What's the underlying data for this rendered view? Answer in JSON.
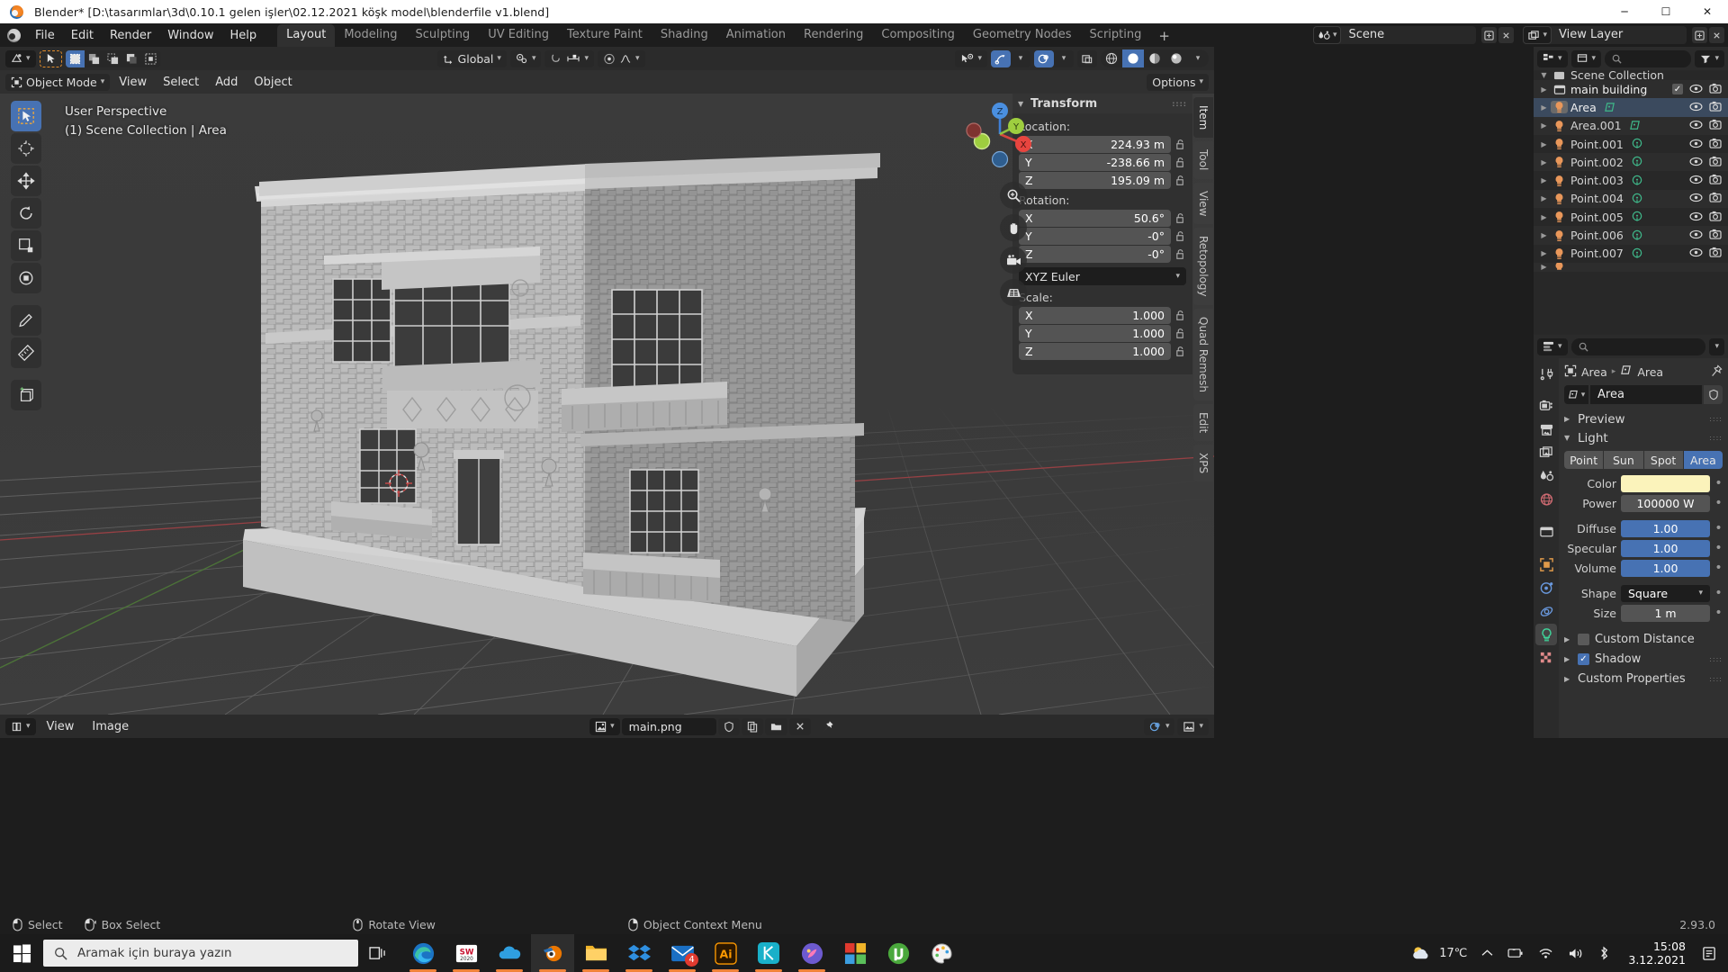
{
  "window": {
    "title": "Blender* [D:\\tasarımlar\\3d\\0.10.1 gelen işler\\02.12.2021 köşk model\\blenderfile v1.blend]",
    "minimize": "─",
    "maximize": "☐",
    "close": "✕"
  },
  "topbar": {
    "menus": [
      "File",
      "Edit",
      "Render",
      "Window",
      "Help"
    ],
    "workspaces": [
      {
        "label": "Layout",
        "active": true
      },
      {
        "label": "Modeling",
        "active": false
      },
      {
        "label": "Sculpting",
        "active": false
      },
      {
        "label": "UV Editing",
        "active": false
      },
      {
        "label": "Texture Paint",
        "active": false
      },
      {
        "label": "Shading",
        "active": false
      },
      {
        "label": "Animation",
        "active": false
      },
      {
        "label": "Rendering",
        "active": false
      },
      {
        "label": "Compositing",
        "active": false
      },
      {
        "label": "Geometry Nodes",
        "active": false
      },
      {
        "label": "Scripting",
        "active": false
      }
    ],
    "add_workspace": "+",
    "scene_name": "Scene",
    "view_layer_name": "View Layer"
  },
  "viewport": {
    "mode": "Object Mode",
    "menus": [
      "View",
      "Select",
      "Add",
      "Object"
    ],
    "transform_orientation": "Global",
    "options_label": "Options",
    "overlay_text_line1": "User Perspective",
    "overlay_text_line2": "(1) Scene Collection | Area",
    "gizmo_axes": [
      "X",
      "Y",
      "Z"
    ]
  },
  "npanel": {
    "title": "Transform",
    "location_label": "Location:",
    "rotation_label": "Rotation:",
    "scale_label": "Scale:",
    "location": [
      {
        "axis": "X",
        "value": "224.93 m"
      },
      {
        "axis": "Y",
        "value": "-238.66 m"
      },
      {
        "axis": "Z",
        "value": "195.09 m"
      }
    ],
    "rotation": [
      {
        "axis": "X",
        "value": "50.6°"
      },
      {
        "axis": "Y",
        "value": "-0°"
      },
      {
        "axis": "Z",
        "value": "-0°"
      }
    ],
    "rotation_mode": "XYZ Euler",
    "scale": [
      {
        "axis": "X",
        "value": "1.000"
      },
      {
        "axis": "Y",
        "value": "1.000"
      },
      {
        "axis": "Z",
        "value": "1.000"
      }
    ],
    "tabs": [
      {
        "label": "Item",
        "active": true
      },
      {
        "label": "Tool",
        "active": false
      },
      {
        "label": "View",
        "active": false
      },
      {
        "label": "Retopology",
        "active": false
      },
      {
        "label": "Quad Remesh",
        "active": false
      },
      {
        "label": "Edit",
        "active": false
      },
      {
        "label": "XPS",
        "active": false
      }
    ]
  },
  "image_editor": {
    "menus": [
      "View",
      "Image"
    ],
    "image_name": "main.png"
  },
  "outliner": {
    "search_placeholder": "",
    "root": "Scene Collection",
    "rows": [
      {
        "name": "main building",
        "icon": "collection-icon",
        "data_icon": "",
        "checkbox": true,
        "selected": false
      },
      {
        "name": "Area",
        "icon": "light-icon",
        "data_icon": "area-light-data-icon",
        "checkbox": false,
        "selected": true
      },
      {
        "name": "Area.001",
        "icon": "light-icon",
        "data_icon": "area-light-data-icon",
        "checkbox": false,
        "selected": false
      },
      {
        "name": "Point.001",
        "icon": "light-icon",
        "data_icon": "point-light-data-icon",
        "checkbox": false,
        "selected": false
      },
      {
        "name": "Point.002",
        "icon": "light-icon",
        "data_icon": "point-light-data-icon",
        "checkbox": false,
        "selected": false
      },
      {
        "name": "Point.003",
        "icon": "light-icon",
        "data_icon": "point-light-data-icon",
        "checkbox": false,
        "selected": false
      },
      {
        "name": "Point.004",
        "icon": "light-icon",
        "data_icon": "point-light-data-icon",
        "checkbox": false,
        "selected": false
      },
      {
        "name": "Point.005",
        "icon": "light-icon",
        "data_icon": "point-light-data-icon",
        "checkbox": false,
        "selected": false
      },
      {
        "name": "Point.006",
        "icon": "light-icon",
        "data_icon": "point-light-data-icon",
        "checkbox": false,
        "selected": false
      },
      {
        "name": "Point.007",
        "icon": "light-icon",
        "data_icon": "point-light-data-icon",
        "checkbox": false,
        "selected": false
      }
    ]
  },
  "properties": {
    "breadcrumb_object": "Area",
    "breadcrumb_data": "Area",
    "id_name": "Area",
    "preview_label": "Preview",
    "light_label": "Light",
    "light_types": [
      {
        "label": "Point",
        "active": false
      },
      {
        "label": "Sun",
        "active": false
      },
      {
        "label": "Spot",
        "active": false
      },
      {
        "label": "Area",
        "active": true
      }
    ],
    "fields": [
      {
        "label": "Color",
        "value": "",
        "kind": "swatch",
        "color": "#fbf3bb"
      },
      {
        "label": "Power",
        "value": "100000 W",
        "kind": "grey"
      },
      {
        "label": "Diffuse",
        "value": "1.00",
        "kind": "blue"
      },
      {
        "label": "Specular",
        "value": "1.00",
        "kind": "blue"
      },
      {
        "label": "Volume",
        "value": "1.00",
        "kind": "blue"
      },
      {
        "label": "Shape",
        "value": "Square",
        "kind": "select"
      },
      {
        "label": "Size",
        "value": "1 m",
        "kind": "grey"
      }
    ],
    "custom_distance_label": "Custom Distance",
    "shadow_label": "Shadow",
    "custom_properties_label": "Custom Properties",
    "accent_blue": "#4772b3",
    "tabs": [
      {
        "name": "tool-tab",
        "active": false
      },
      {
        "name": "render-tab",
        "active": false
      },
      {
        "name": "output-tab",
        "active": false
      },
      {
        "name": "view-layer-tab",
        "active": false
      },
      {
        "name": "scene-tab",
        "active": false
      },
      {
        "name": "world-tab",
        "active": false
      },
      {
        "name": "collection-tab",
        "active": false
      },
      {
        "name": "object-tab",
        "active": false
      },
      {
        "name": "modifier-tab",
        "active": false
      },
      {
        "name": "physics-tab",
        "active": false
      },
      {
        "name": "data-light-tab",
        "active": true
      },
      {
        "name": "material-tab",
        "active": false
      }
    ]
  },
  "statusbar": {
    "items": [
      {
        "label": "Select",
        "mouse": "left"
      },
      {
        "label": "Box Select",
        "mouse": "left-drag"
      },
      {
        "label": "Rotate View",
        "mouse": "middle"
      },
      {
        "label": "Object Context Menu",
        "mouse": "right"
      }
    ],
    "version": "2.93.0"
  },
  "taskbar": {
    "search_placeholder": "Aramak için buraya yazın",
    "weather_temp": "17℃",
    "clock_time": "15:08",
    "clock_date": "3.12.2021",
    "mail_badge": "4",
    "apps": [
      {
        "name": "edge",
        "running": true
      },
      {
        "name": "solidworks",
        "running": true
      },
      {
        "name": "onedrive-blue",
        "running": true
      },
      {
        "name": "blender",
        "running": true,
        "active": true
      },
      {
        "name": "file-explorer",
        "running": true
      },
      {
        "name": "dropbox",
        "running": true
      },
      {
        "name": "mail",
        "running": true
      },
      {
        "name": "illustrator",
        "running": true
      },
      {
        "name": "keyshot",
        "running": true
      },
      {
        "name": "paint3d",
        "running": true
      },
      {
        "name": "windows-store",
        "running": false
      },
      {
        "name": "utorrent",
        "running": false
      },
      {
        "name": "paint",
        "running": false
      }
    ]
  }
}
